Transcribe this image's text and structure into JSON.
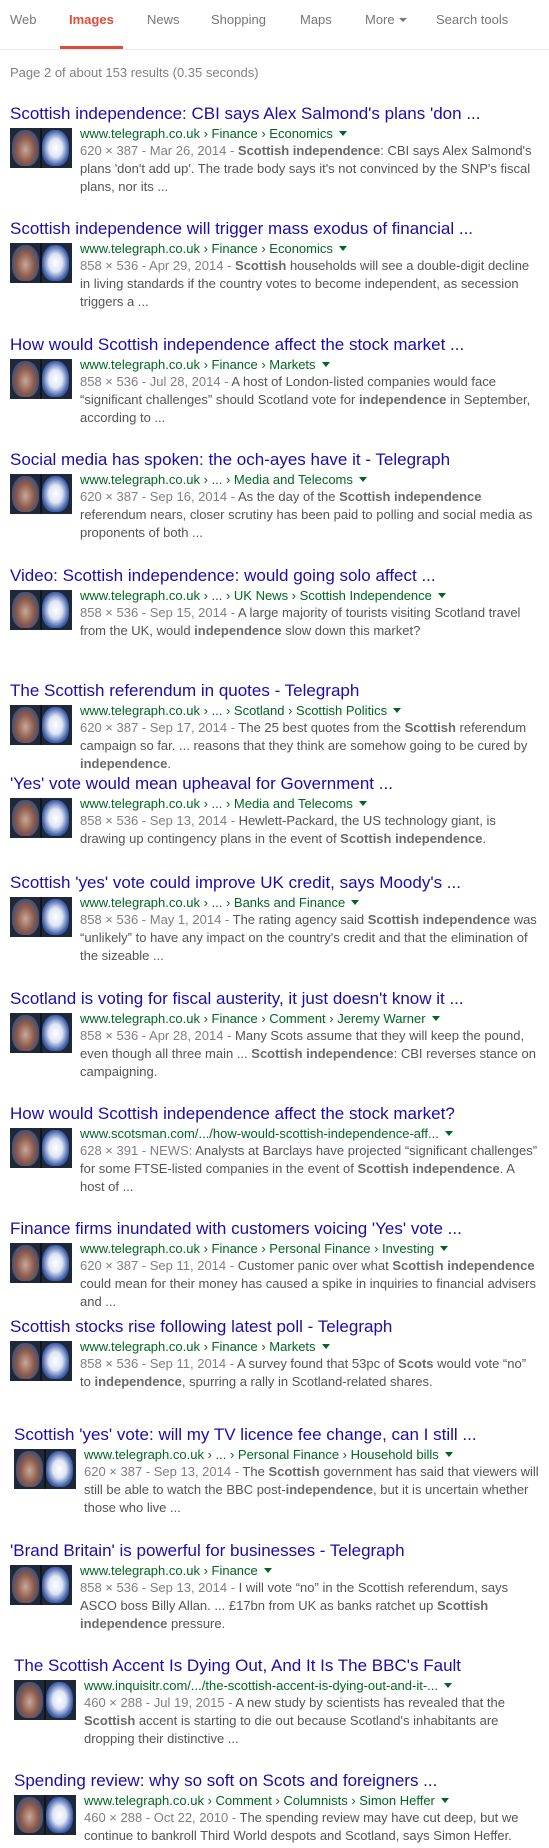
{
  "nav": {
    "tabs": [
      {
        "label": "Web"
      },
      {
        "label": "Images"
      },
      {
        "label": "News"
      },
      {
        "label": "Shopping"
      },
      {
        "label": "Maps"
      },
      {
        "label": "More"
      },
      {
        "label": "Search tools"
      }
    ]
  },
  "stats": "Page 2 of about 153 results (0.35 seconds)",
  "results": [
    {
      "title": "Scottish independence: CBI says Alex Salmond's plans 'don ...",
      "url": "www.telegraph.co.uk › Finance › Economics",
      "meta": "620 × 387 - Mar 26, 2014 - ",
      "snippet": "<b>Scottish independence</b>: CBI says Alex Salmond's plans 'don't add up'. The trade body says it's not convinced by the SNP's fiscal plans, nor its ..."
    },
    {
      "title": "Scottish independence will trigger mass exodus of financial ...",
      "url": "www.telegraph.co.uk › Finance › Economics",
      "meta": "858 × 536 - Apr 29, 2014 - ",
      "snippet": "<b>Scottish</b> households will see a double-digit decline in living standards if the country votes to become independent, as secession triggers a ..."
    },
    {
      "title": "How would Scottish independence affect the stock market ...",
      "url": "www.telegraph.co.uk › Finance › Markets",
      "meta": "858 × 536 - Jul 28, 2014 - ",
      "snippet": "A host of London-listed companies would face “significant challenges” should Scotland vote for <b>independence</b> in September, according to ..."
    },
    {
      "title": "Social media has spoken: the och-ayes have it - Telegraph",
      "url": "www.telegraph.co.uk › ... › Media and Telecoms",
      "meta": "620 × 387 - Sep 16, 2014 - ",
      "snippet": "As the day of the <b>Scottish independence</b> referendum nears, closer scrutiny has been paid to polling and social media as proponents of both ..."
    },
    {
      "title": "Video: Scottish independence: would going solo affect ...",
      "url": "www.telegraph.co.uk › ... › UK News › Scottish Independence",
      "meta": "858 × 536 - Sep 15, 2014 - ",
      "snippet": "A large majority of tourists visiting Scotland travel from the UK, would <b>independence</b> slow down this market?"
    },
    {
      "title": "The Scottish referendum in quotes - Telegraph",
      "url": "www.telegraph.co.uk › ... › Scotland › Scottish Politics",
      "meta": "620 × 387 - Sep 17, 2014 - ",
      "snippet": "The 25 best quotes from the <b>Scottish</b> referendum campaign so far. ... reasons that they think are somehow going to be cured by <b>independence</b>."
    },
    {
      "title": "'Yes' vote would mean upheaval for Government ...",
      "url": "www.telegraph.co.uk › ... › Media and Telecoms",
      "meta": "858 × 536 - Sep 13, 2014 - ",
      "snippet": "Hewlett-Packard, the US technology giant, is drawing up contingency plans in the event of <b>Scottish independence</b>."
    },
    {
      "title": "Scottish 'yes' vote could improve UK credit, says Moody's ...",
      "url": "www.telegraph.co.uk › ... › Banks and Finance",
      "meta": "858 × 536 - May 1, 2014 - ",
      "snippet": "The rating agency said <b>Scottish independence</b> was “unlikely” to have any impact on the country's credit and that the elimination of the sizeable ..."
    },
    {
      "title": "Scotland is voting for fiscal austerity, it just doesn't know it ...",
      "url": "www.telegraph.co.uk › Finance › Comment › Jeremy Warner",
      "meta": "858 × 536 - Apr 28, 2014 - ",
      "snippet": "Many Scots assume that they will keep the pound, even though all three main ... <b>Scottish independence</b>: CBI reverses stance on campaigning."
    },
    {
      "title": "How would Scottish independence affect the stock market?",
      "url": "www.scotsman.com/.../how-would-scottish-independence-aff...",
      "meta": "628 × 391 - NEWS: ",
      "snippet": "Analysts at Barclays have projected “significant challenges” for some FTSE-listed companies in the event of <b>Scottish independence</b>. A host of ..."
    },
    {
      "title": "Finance firms inundated with customers voicing 'Yes' vote ...",
      "url": "www.telegraph.co.uk › Finance › Personal Finance › Investing",
      "meta": "620 × 387 - Sep 11, 2014 - ",
      "snippet": "Customer panic over what <b>Scottish independence</b> could mean for their money has caused a spike in inquiries to financial advisers and ..."
    },
    {
      "title": "Scottish stocks rise following latest poll - Telegraph",
      "url": "www.telegraph.co.uk › Finance › Markets",
      "meta": "858 × 536 - Sep 11, 2014 - ",
      "snippet": "A survey found that 53pc of <b>Scots</b> would vote “no” to <b>independence</b>, spurring a rally in Scotland-related shares."
    },
    {
      "title": "Scottish 'yes' vote: will my TV licence fee change, can I still ...",
      "url": "www.telegraph.co.uk › ... › Personal Finance › Household bills",
      "meta": "620 × 387 - Sep 13, 2014 - ",
      "snippet": "The <b>Scottish</b> government has said that viewers will still be able to watch the BBC post-<b>independence</b>, but it is uncertain whether those who live ..."
    },
    {
      "title": "'Brand Britain' is powerful for businesses - Telegraph",
      "url": "www.telegraph.co.uk › Finance",
      "meta": "858 × 536 - Sep 13, 2014 - ",
      "snippet": "I will vote “no” in the Scottish referendum, says ASCO boss Billy Allan. ... £17bn from UK as banks ratchet up <b>Scottish independence</b> pressure."
    },
    {
      "title": "The Scottish Accent Is Dying Out, And It Is The BBC's Fault",
      "url": "www.inquisitr.com/.../the-scottish-accent-is-dying-out-and-it-...",
      "meta": "460 × 288 - Jul 19, 2015 - ",
      "snippet": "A new study by scientists has revealed that the <b>Scottish</b> accent is starting to die out because Scotland's inhabitants are dropping their distinctive ..."
    },
    {
      "title": "Spending review: why so soft on Scots and foreigners ...",
      "url": "www.telegraph.co.uk › Comment › Columnists › Simon Heffer",
      "meta": "460 × 288 - Oct 22, 2010 - ",
      "snippet": "The spending review may have cut deep, but we continue to bankroll Third World despots and Scotland, says Simon Heffer."
    }
  ]
}
